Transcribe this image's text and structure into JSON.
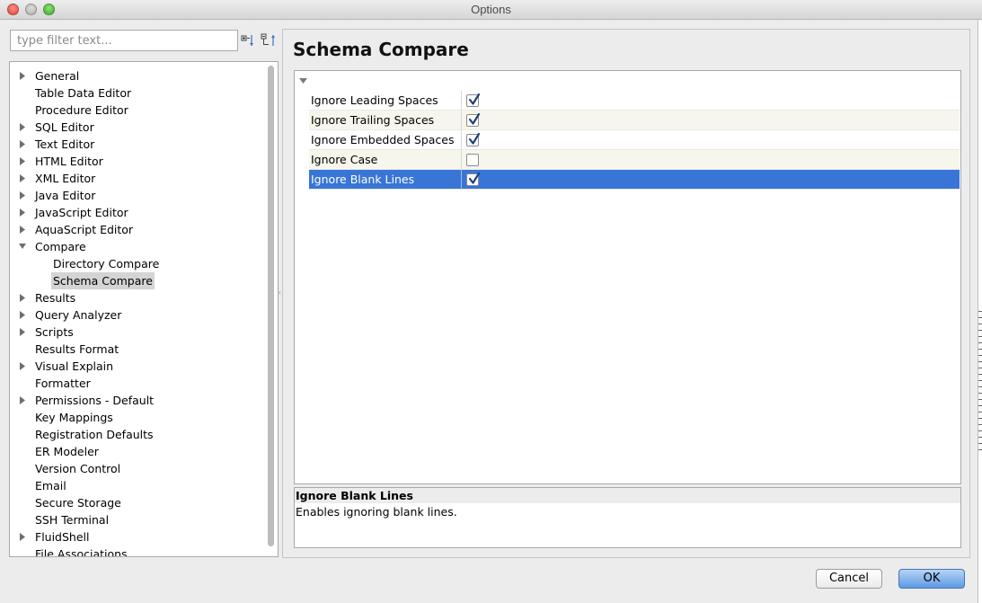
{
  "window": {
    "title": "Options"
  },
  "filter": {
    "placeholder": "type filter text..."
  },
  "tree": {
    "items": [
      {
        "label": "General",
        "expandable": true,
        "expanded": false,
        "level": 0
      },
      {
        "label": "Table Data Editor",
        "expandable": false,
        "level": 0
      },
      {
        "label": "Procedure Editor",
        "expandable": false,
        "level": 0
      },
      {
        "label": "SQL Editor",
        "expandable": true,
        "expanded": false,
        "level": 0
      },
      {
        "label": "Text Editor",
        "expandable": true,
        "expanded": false,
        "level": 0
      },
      {
        "label": "HTML Editor",
        "expandable": true,
        "expanded": false,
        "level": 0
      },
      {
        "label": "XML Editor",
        "expandable": true,
        "expanded": false,
        "level": 0
      },
      {
        "label": "Java Editor",
        "expandable": true,
        "expanded": false,
        "level": 0
      },
      {
        "label": "JavaScript Editor",
        "expandable": true,
        "expanded": false,
        "level": 0
      },
      {
        "label": "AquaScript Editor",
        "expandable": true,
        "expanded": false,
        "level": 0
      },
      {
        "label": "Compare",
        "expandable": true,
        "expanded": true,
        "level": 0
      },
      {
        "label": "Directory Compare",
        "expandable": false,
        "level": 1
      },
      {
        "label": "Schema Compare",
        "expandable": false,
        "level": 1,
        "selected": true
      },
      {
        "label": "Results",
        "expandable": true,
        "expanded": false,
        "level": 0
      },
      {
        "label": "Query Analyzer",
        "expandable": true,
        "expanded": false,
        "level": 0
      },
      {
        "label": "Scripts",
        "expandable": true,
        "expanded": false,
        "level": 0
      },
      {
        "label": "Results Format",
        "expandable": false,
        "level": 0
      },
      {
        "label": "Visual Explain",
        "expandable": true,
        "expanded": false,
        "level": 0
      },
      {
        "label": "Formatter",
        "expandable": false,
        "level": 0
      },
      {
        "label": "Permissions - Default",
        "expandable": true,
        "expanded": false,
        "level": 0
      },
      {
        "label": "Key Mappings",
        "expandable": false,
        "level": 0
      },
      {
        "label": "Registration Defaults",
        "expandable": false,
        "level": 0
      },
      {
        "label": "ER Modeler",
        "expandable": false,
        "level": 0
      },
      {
        "label": "Version Control",
        "expandable": false,
        "level": 0
      },
      {
        "label": "Email",
        "expandable": false,
        "level": 0
      },
      {
        "label": "Secure Storage",
        "expandable": false,
        "level": 0
      },
      {
        "label": "SSH Terminal",
        "expandable": false,
        "level": 0
      },
      {
        "label": "FluidShell",
        "expandable": true,
        "expanded": false,
        "level": 0
      },
      {
        "label": "File Associations",
        "expandable": false,
        "level": 0
      }
    ]
  },
  "page": {
    "title": "Schema Compare",
    "properties": [
      {
        "name": "Ignore Leading Spaces",
        "checked": true
      },
      {
        "name": "Ignore Trailing Spaces",
        "checked": true
      },
      {
        "name": "Ignore Embedded Spaces",
        "checked": true
      },
      {
        "name": "Ignore Case",
        "checked": false
      },
      {
        "name": "Ignore Blank Lines",
        "checked": true,
        "selected": true
      }
    ],
    "description": {
      "title": "Ignore Blank Lines",
      "text": "Enables ignoring blank lines."
    }
  },
  "buttons": {
    "cancel": "Cancel",
    "ok": "OK"
  },
  "colors": {
    "selection": "#3875d7",
    "ok_button": "#5d9ae4",
    "alt_row": "#f7f6ec"
  }
}
